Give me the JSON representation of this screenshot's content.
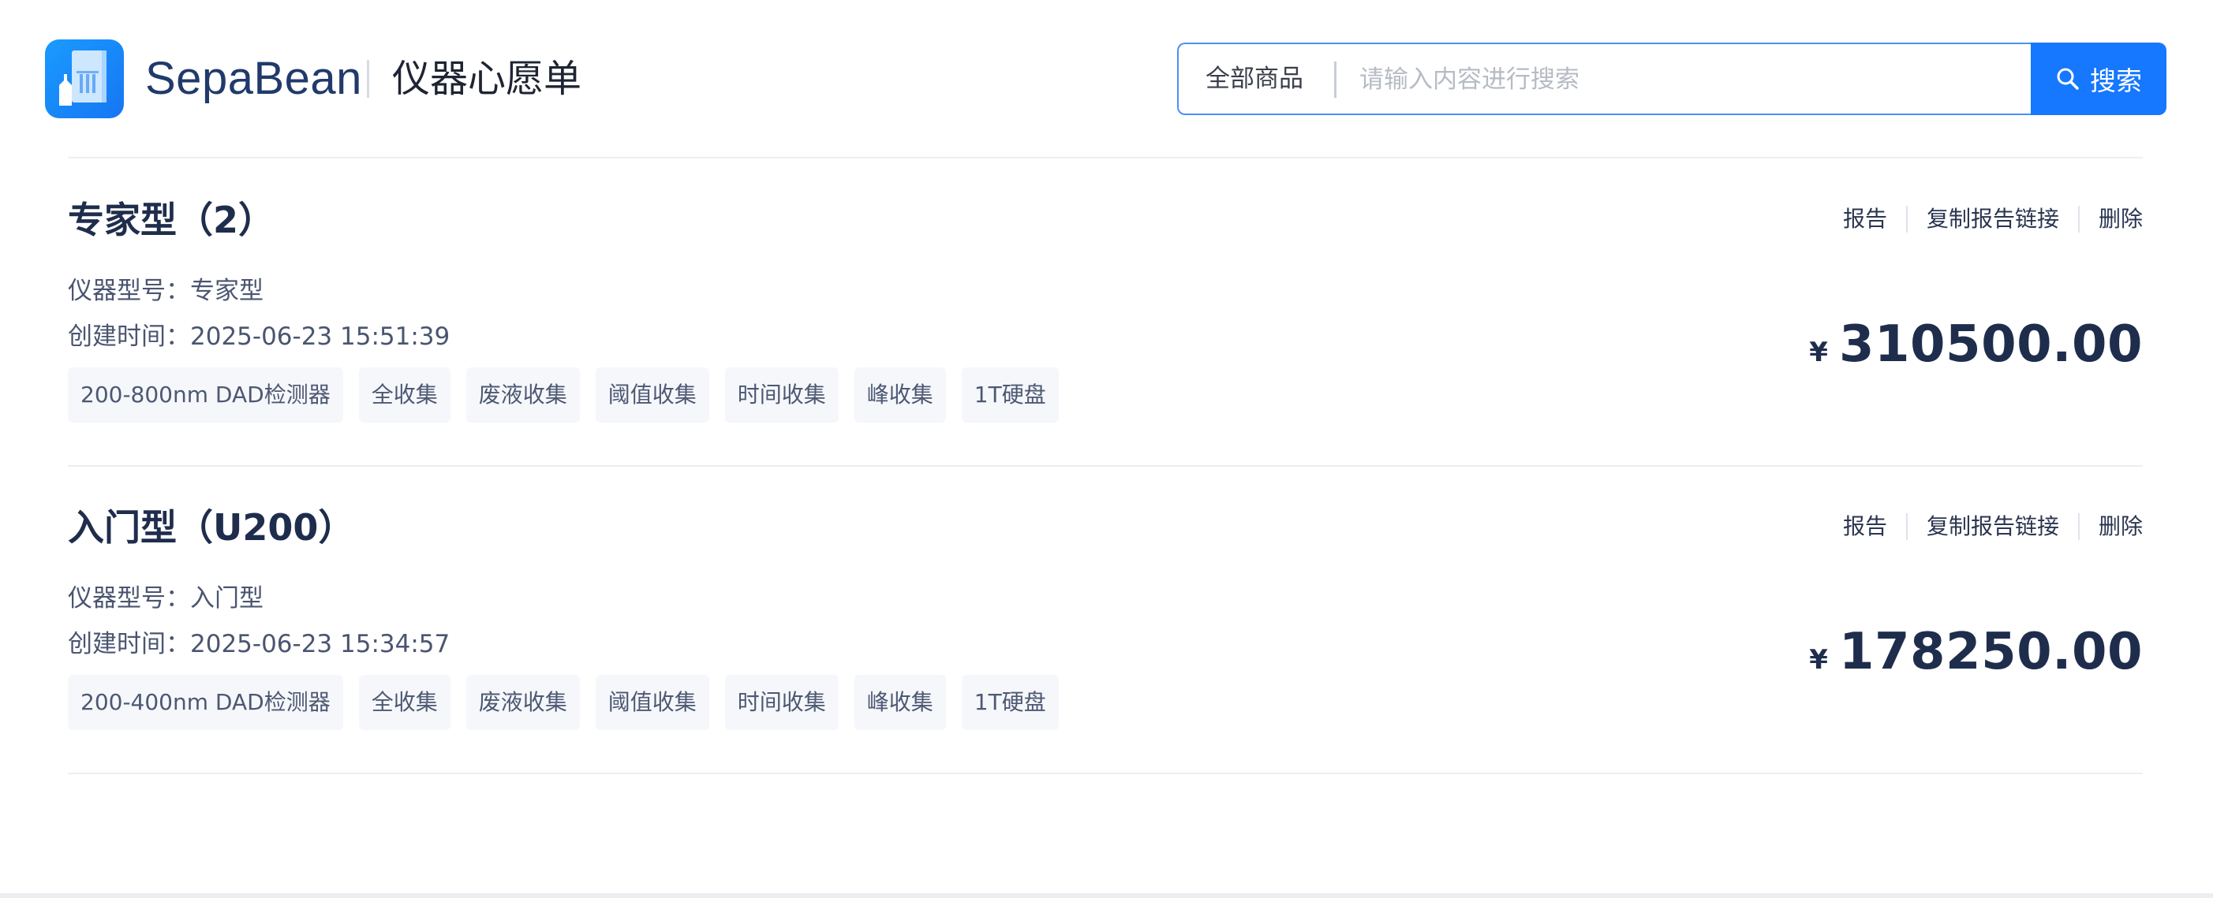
{
  "header": {
    "brand": "SepaBean",
    "subtitle": "仪器心愿单",
    "search": {
      "scope": "全部商品",
      "placeholder": "请输入内容进行搜索",
      "value": "",
      "button_label": "搜索",
      "button_icon": "search-icon"
    },
    "logo_icon": "sepabean-logo-icon"
  },
  "items": [
    {
      "title": "专家型（2）",
      "model_label": "仪器型号：",
      "model": "专家型",
      "created_label": "创建时间：",
      "created": "2025-06-23 15:51:39",
      "tags": [
        "200-800nm DAD检测器",
        "全收集",
        "废液收集",
        "阈值收集",
        "时间收集",
        "峰收集",
        "1T硬盘"
      ],
      "actions": {
        "report": "报告",
        "copy_link": "复制报告链接",
        "delete": "删除"
      },
      "currency": "¥",
      "price": "310500.00"
    },
    {
      "title": "入门型（U200）",
      "model_label": "仪器型号：",
      "model": "入门型",
      "created_label": "创建时间：",
      "created": "2025-06-23 15:34:57",
      "tags": [
        "200-400nm DAD检测器",
        "全收集",
        "废液收集",
        "阈值收集",
        "时间收集",
        "峰收集",
        "1T硬盘"
      ],
      "actions": {
        "report": "报告",
        "copy_link": "复制报告链接",
        "delete": "删除"
      },
      "currency": "¥",
      "price": "178250.00"
    }
  ],
  "colors": {
    "accent": "#1677ff",
    "title_text": "#1f2d4d",
    "brand_text": "#213a6b",
    "tag_bg": "#f5f7fa"
  }
}
